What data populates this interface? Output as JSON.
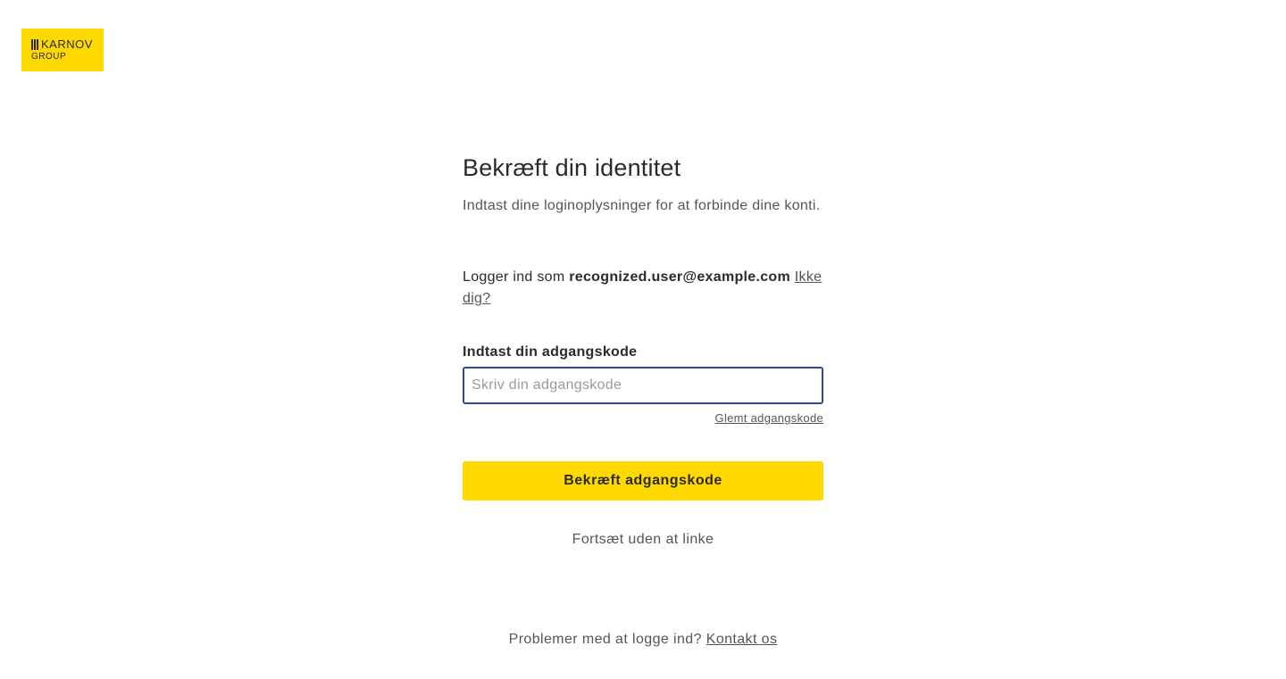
{
  "logo": {
    "word": "KARNOV",
    "sub": "GROUP"
  },
  "auth": {
    "title": "Bekræft din identitet",
    "subtitle": "Indtast dine loginoplysninger for at forbinde dine konti.",
    "logged_in_prefix": "Logger ind som",
    "email": "recognized.user@example.com",
    "not_you": "Ikke dig?",
    "password_label": "Indtast din adgangskode",
    "password_placeholder": "Skriv din adgangskode",
    "password_value": "",
    "forgot_password": "Glemt adgangskode",
    "confirm_button": "Bekræft adgangskode",
    "continue_without_link": "Fortsæt uden at linke"
  },
  "footer": {
    "problem_text": "Problemer med at logge ind?",
    "contact_link": "Kontakt os"
  },
  "colors": {
    "brand_yellow": "#ffd800",
    "input_focus_border": "#1f4f8f",
    "text_dark": "#2b2b2b",
    "text_muted": "#555555"
  }
}
